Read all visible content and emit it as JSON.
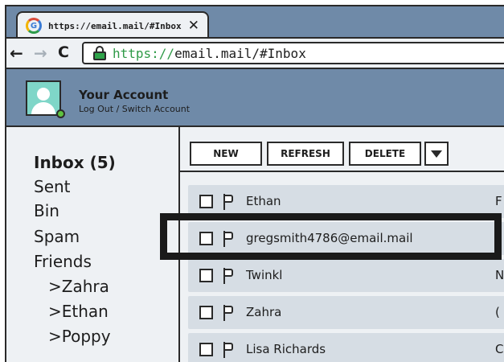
{
  "browser": {
    "tab_title": "https://email.mail/#Inbox",
    "tab_close": "✕",
    "tab_icon": "G",
    "url_scheme": "https://",
    "url_rest": "email.mail/#Inbox",
    "nav_back": "←",
    "nav_forward": "→",
    "nav_reload": "C"
  },
  "account": {
    "name": "Your Account",
    "links": "Log Out / Switch Account"
  },
  "sidebar": {
    "items": [
      {
        "label": "Inbox (5)"
      },
      {
        "label": "Sent"
      },
      {
        "label": "Bin"
      },
      {
        "label": "Spam"
      },
      {
        "label": "Friends"
      },
      {
        "label": ">Zahra"
      },
      {
        "label": ">Ethan"
      },
      {
        "label": ">Poppy"
      }
    ]
  },
  "toolbar": {
    "new_label": "NEW",
    "refresh_label": "REFRESH",
    "delete_label": "DELETE"
  },
  "emails": [
    {
      "sender": "Ethan",
      "subject_fragment": "F"
    },
    {
      "sender": "gregsmith4786@email.mail",
      "subject_fragment": ""
    },
    {
      "sender": "Twinkl",
      "subject_fragment": "N"
    },
    {
      "sender": "Zahra",
      "subject_fragment": "("
    },
    {
      "sender": "Lisa Richards",
      "subject_fragment": "C"
    }
  ],
  "colors": {
    "header_blue": "#6f8aa8",
    "panel_bg": "#eef1f4",
    "row_bg": "#d6dde4",
    "secure_green": "#2f9a47"
  }
}
